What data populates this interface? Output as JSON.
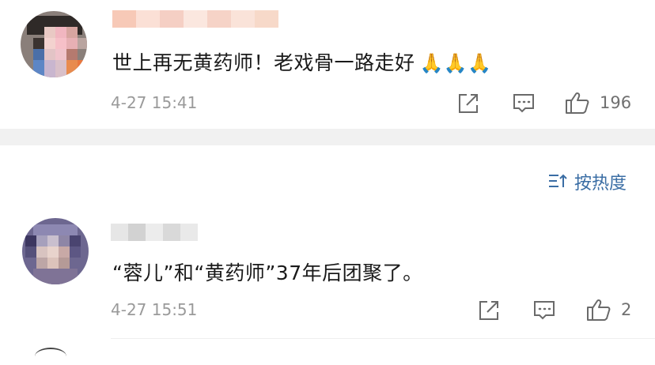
{
  "comments": [
    {
      "text": "世上再无黄药师！老戏骨一路走好",
      "emoji": "🙏🙏🙏",
      "timestamp": "4-27 15:41",
      "likes": "196"
    },
    {
      "text": "“蓉儿”和“黄药师”37年后团聚了。",
      "timestamp": "4-27 15:51",
      "likes": "2"
    }
  ],
  "sort": {
    "label": "按热度",
    "icon": "sort-icon"
  },
  "icons": {
    "share": "share-icon",
    "comment": "comment-icon",
    "like": "thumbs-up-icon"
  },
  "colors": {
    "link_blue": "#3a6da4",
    "meta_gray": "#9a9a9a",
    "band": "#f1f1f1"
  }
}
